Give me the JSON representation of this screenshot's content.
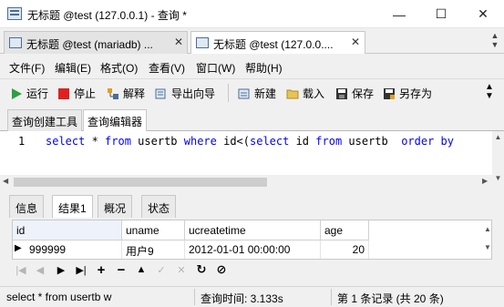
{
  "window": {
    "title": "无标题 @test (127.0.0.1) - 查询 *",
    "minimize": "—",
    "maximize": "☐",
    "close": "✕"
  },
  "doc_tabs": [
    {
      "label": "无标题 @test (mariadb) ...",
      "close": "✕"
    },
    {
      "label": "无标题 @test (127.0.0....",
      "close": "✕"
    }
  ],
  "menu": [
    "文件(F)",
    "编辑(E)",
    "格式(O)",
    "查看(V)",
    "窗口(W)",
    "帮助(H)"
  ],
  "toolbar": {
    "run": "运行",
    "stop": "停止",
    "explain": "解释",
    "export": "导出向导",
    "new": "新建",
    "load": "载入",
    "save": "保存",
    "save_as": "另存为"
  },
  "sub_tabs": [
    "查询创建工具",
    "查询编辑器"
  ],
  "editor": {
    "line_number": "1",
    "code": [
      {
        "t": "select",
        "kw": true
      },
      {
        "t": " * ",
        "kw": false
      },
      {
        "t": "from",
        "kw": true
      },
      {
        "t": " usertb ",
        "kw": false
      },
      {
        "t": "where",
        "kw": true
      },
      {
        "t": " id<(",
        "kw": false
      },
      {
        "t": "select",
        "kw": true
      },
      {
        "t": " id ",
        "kw": false
      },
      {
        "t": "from",
        "kw": true
      },
      {
        "t": " usertb  ",
        "kw": false
      },
      {
        "t": "order by",
        "kw": true
      }
    ]
  },
  "result_tabs": [
    "信息",
    "结果1",
    "概况",
    "状态"
  ],
  "grid": {
    "columns": [
      "id",
      "uname",
      "ucreatetime",
      "age"
    ],
    "rows": [
      {
        "marker": "▶",
        "cells": [
          "999999",
          "用户9",
          "2012-01-01 00:00:00",
          "20"
        ]
      }
    ]
  },
  "status": {
    "sql": "select * from usertb w",
    "query_time": "查询时间: 3.133s",
    "records": "第 1 条记录 (共 20 条)"
  },
  "colors": {
    "keyword": "#0000ff",
    "run_icon": "#2ea043",
    "stop_icon": "#e02020"
  }
}
